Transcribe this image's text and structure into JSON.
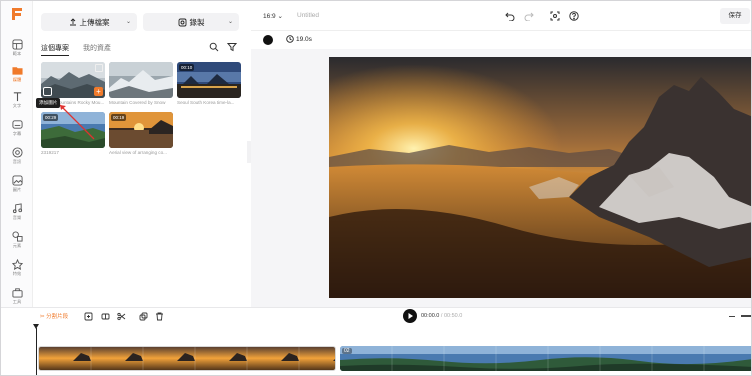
{
  "toolbar": {
    "upload_label": "上傳檔案",
    "record_label": "錄製"
  },
  "rail": {
    "items": [
      {
        "label": "範本",
        "icon": "template-icon"
      },
      {
        "label": "媒體",
        "icon": "media-icon",
        "active": true
      },
      {
        "label": "文字",
        "icon": "text-icon"
      },
      {
        "label": "字幕",
        "icon": "subtitle-icon"
      },
      {
        "label": "音訊",
        "icon": "audio-icon"
      },
      {
        "label": "圖片",
        "icon": "image-icon"
      },
      {
        "label": "音樂",
        "icon": "music-icon"
      },
      {
        "label": "元素",
        "icon": "elements-icon"
      },
      {
        "label": "特效",
        "icon": "effects-icon"
      },
      {
        "label": "工具",
        "icon": "tools-icon"
      }
    ]
  },
  "panel": {
    "tabs": [
      {
        "label": "這個專案",
        "active": true
      },
      {
        "label": "我的資產",
        "active": false
      }
    ],
    "tooltip": "添加圖片",
    "thumbs": [
      {
        "duration": "",
        "caption": "Rocky Mountains Rocky Mou..."
      },
      {
        "duration": "",
        "caption": "Mountain Covered by Snow"
      },
      {
        "duration": "00:10",
        "caption": "Seoul South Korea time-la..."
      },
      {
        "duration": "00:29",
        "caption": "2319217"
      },
      {
        "duration": "00:19",
        "caption": "Aerial view of arranging co..."
      }
    ]
  },
  "topbar": {
    "aspect_ratio": "16:9",
    "project_title": "Untitled",
    "save_label": "保存"
  },
  "subbar": {
    "duration": "19.0s"
  },
  "timeline": {
    "split_label": "分割片段",
    "current_time": "00:00.0",
    "total_time": "00:50.0",
    "clip2_badge": "02"
  },
  "colors": {
    "accent": "#f07a2b"
  }
}
